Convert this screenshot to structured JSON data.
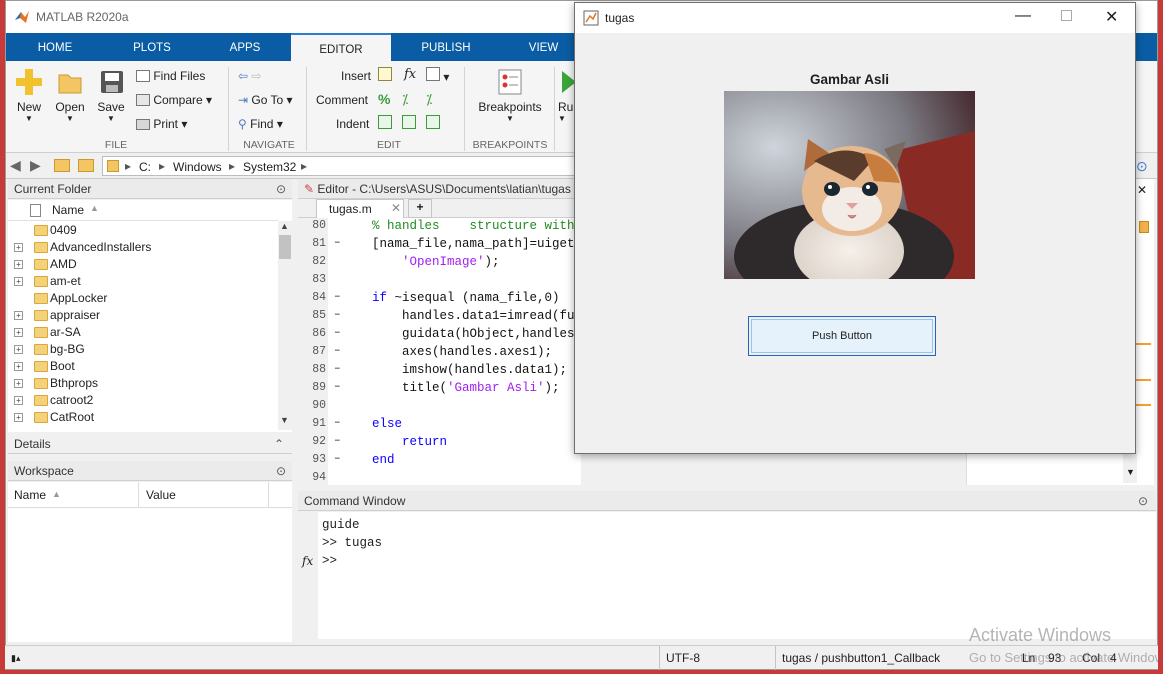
{
  "app": {
    "title": "MATLAB R2020a"
  },
  "tabs": [
    "HOME",
    "PLOTS",
    "APPS",
    "EDITOR",
    "PUBLISH",
    "VIEW"
  ],
  "ribbon": {
    "file": {
      "new": "New",
      "open": "Open",
      "save": "Save",
      "find_files": "Find Files",
      "compare": "Compare",
      "print": "Print",
      "group": "FILE"
    },
    "navigate": {
      "go_to": "Go To",
      "find": "Find",
      "group": "NAVIGATE"
    },
    "edit": {
      "insert": "Insert",
      "fx": "fx",
      "comment": "Comment",
      "comment_sym": "%",
      "indent": "Indent",
      "group": "EDIT"
    },
    "breakpoints": {
      "label": "Breakpoints",
      "group": "BREAKPOINTS"
    },
    "run": {
      "label": "Ru"
    }
  },
  "address": {
    "drive": "C:",
    "parts": [
      "Windows",
      "System32"
    ]
  },
  "current_folder": {
    "title": "Current Folder",
    "column": "Name",
    "items": [
      "0409",
      "AdvancedInstallers",
      "AMD",
      "am-et",
      "AppLocker",
      "appraiser",
      "ar-SA",
      "bg-BG",
      "Boot",
      "Bthprops",
      "catroot2",
      "CatRoot"
    ]
  },
  "details": {
    "title": "Details"
  },
  "workspace": {
    "title": "Workspace",
    "col_name": "Name",
    "col_value": "Value"
  },
  "editor": {
    "title": "Editor - C:\\Users\\ASUS\\Documents\\latian\\tugas",
    "tab": "tugas.m",
    "lines": [
      {
        "n": "80",
        "code": "% handles    structure with"
      },
      {
        "n": "81",
        "code": "[nama_file,nama_path]=uiget"
      },
      {
        "n": "82",
        "code": "    'OpenImage');"
      },
      {
        "n": "83",
        "code": ""
      },
      {
        "n": "84",
        "code": "if ~isequal (nama_file,0)"
      },
      {
        "n": "85",
        "code": "    handles.data1=imread(fu"
      },
      {
        "n": "86",
        "code": "    guidata(hObject,handles"
      },
      {
        "n": "87",
        "code": "    axes(handles.axes1);"
      },
      {
        "n": "88",
        "code": "    imshow(handles.data1);"
      },
      {
        "n": "89",
        "code": "    title('Gambar Asli');"
      },
      {
        "n": "90",
        "code": ""
      },
      {
        "n": "91",
        "code": "else"
      },
      {
        "n": "92",
        "code": "    return"
      },
      {
        "n": "93",
        "code": "end"
      },
      {
        "n": "94",
        "code": ""
      }
    ]
  },
  "command_window": {
    "title": "Command Window",
    "lines": [
      "guide",
      ">> tugas"
    ],
    "prompt": ">>",
    "fx": "fx"
  },
  "figure": {
    "title": "tugas",
    "axes_title": "Gambar Asli",
    "button": "Push Button"
  },
  "status": {
    "encoding": "UTF-8",
    "function": "tugas / pushbutton1_Callback",
    "ln_label": "Ln",
    "ln": "93",
    "col_label": "Col",
    "col": "4"
  },
  "watermark": {
    "line1": "Activate Windows",
    "line2": "Go to Settings to activate Windows."
  },
  "colors": {
    "ribbon_tab_bar": "#0a5da4",
    "desktop": "#c83a3a",
    "keyword": "#0e00ff",
    "string": "#a020f0",
    "comment": "#228b22"
  }
}
